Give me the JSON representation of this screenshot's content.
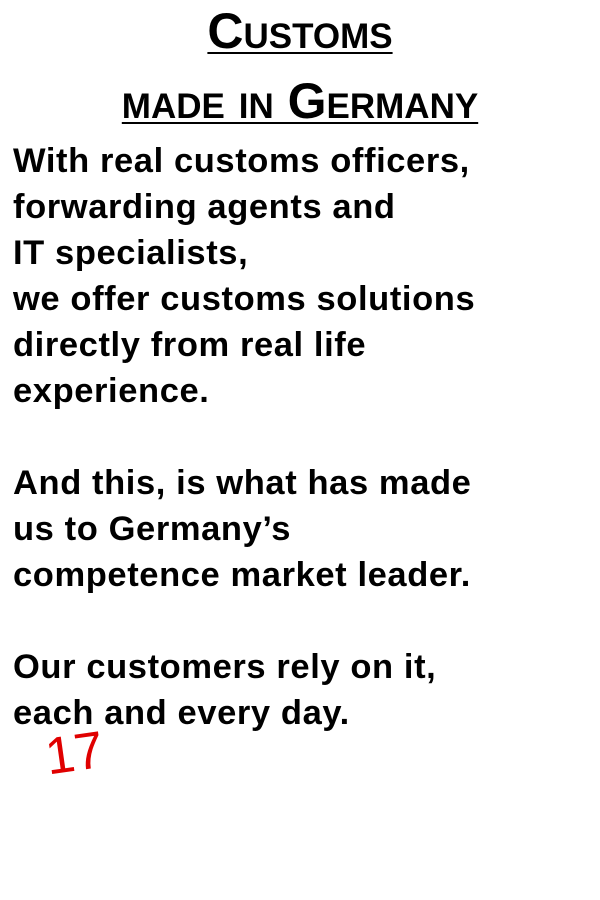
{
  "heading": {
    "line1": "Customs",
    "line2": "made in Germany"
  },
  "body": {
    "paragraph1": [
      "With real customs officers,",
      "forwarding agents and",
      "IT specialists,",
      "we offer customs solutions",
      "directly from real life",
      "experience."
    ],
    "paragraph2": [
      "And this, is what has made",
      "us to Germany’s",
      "competence market leader."
    ],
    "paragraph3": [
      "Our customers rely on it,",
      "each and every day."
    ]
  },
  "page_marker": {
    "text": "17",
    "color": "#e00000"
  }
}
